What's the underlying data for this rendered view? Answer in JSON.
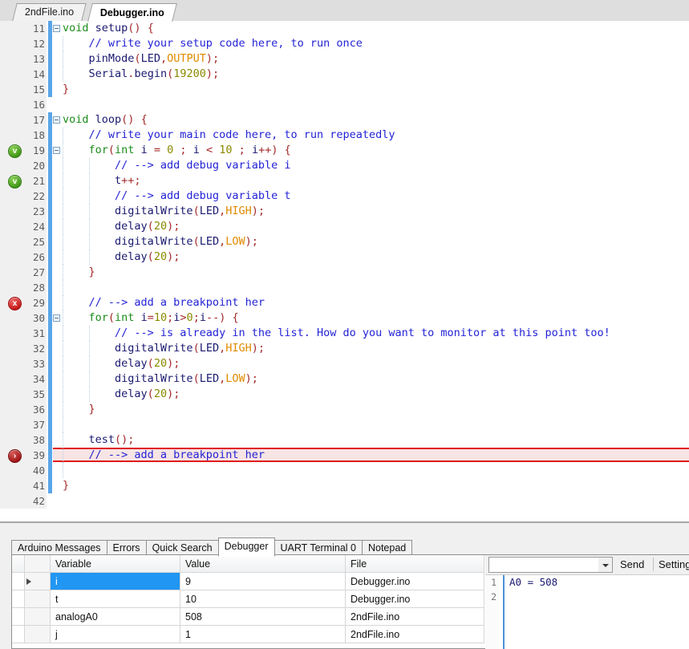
{
  "editor_tabs": [
    {
      "label": "2ndFile.ino",
      "active": false
    },
    {
      "label": "Debugger.ino",
      "active": true
    }
  ],
  "code": {
    "first_line": 11,
    "lines": [
      {
        "n": 11,
        "fold": true,
        "modified": true,
        "indent": 0,
        "marker": "none",
        "tokens": [
          {
            "t": "void",
            "c": "kw"
          },
          {
            "t": " ",
            "c": "pl"
          },
          {
            "t": "setup",
            "c": "id"
          },
          {
            "t": "()",
            "c": "op"
          },
          {
            "t": " ",
            "c": "pl"
          },
          {
            "t": "{",
            "c": "op"
          }
        ]
      },
      {
        "n": 12,
        "fold": false,
        "modified": true,
        "indent": 1,
        "marker": "none",
        "tokens": [
          {
            "t": "    // write your setup code here, to run once",
            "c": "cmt"
          }
        ]
      },
      {
        "n": 13,
        "fold": false,
        "modified": true,
        "indent": 1,
        "marker": "none",
        "tokens": [
          {
            "t": "    ",
            "c": "pl"
          },
          {
            "t": "pinMode",
            "c": "id"
          },
          {
            "t": "(",
            "c": "op"
          },
          {
            "t": "LED",
            "c": "id"
          },
          {
            "t": ",",
            "c": "op"
          },
          {
            "t": "OUTPUT",
            "c": "cst"
          },
          {
            "t": ");",
            "c": "op"
          }
        ]
      },
      {
        "n": 14,
        "fold": false,
        "modified": true,
        "indent": 1,
        "marker": "none",
        "tokens": [
          {
            "t": "    ",
            "c": "pl"
          },
          {
            "t": "Serial",
            "c": "id"
          },
          {
            "t": ".",
            "c": "op"
          },
          {
            "t": "begin",
            "c": "id"
          },
          {
            "t": "(",
            "c": "op"
          },
          {
            "t": "19200",
            "c": "num"
          },
          {
            "t": ");",
            "c": "op"
          }
        ]
      },
      {
        "n": 15,
        "fold": false,
        "modified": true,
        "indent": 0,
        "marker": "none",
        "tokens": [
          {
            "t": "}",
            "c": "op"
          }
        ]
      },
      {
        "n": 16,
        "fold": false,
        "modified": false,
        "indent": 0,
        "marker": "none",
        "tokens": []
      },
      {
        "n": 17,
        "fold": true,
        "modified": true,
        "indent": 0,
        "marker": "none",
        "tokens": [
          {
            "t": "void",
            "c": "kw"
          },
          {
            "t": " ",
            "c": "pl"
          },
          {
            "t": "loop",
            "c": "id"
          },
          {
            "t": "()",
            "c": "op"
          },
          {
            "t": " ",
            "c": "pl"
          },
          {
            "t": "{",
            "c": "op"
          }
        ]
      },
      {
        "n": 18,
        "fold": false,
        "modified": true,
        "indent": 1,
        "marker": "none",
        "tokens": [
          {
            "t": "    // write your main code here, to run repeatedly",
            "c": "cmt"
          }
        ]
      },
      {
        "n": 19,
        "fold": true,
        "modified": true,
        "indent": 1,
        "marker": "ok",
        "tokens": [
          {
            "t": "    ",
            "c": "pl"
          },
          {
            "t": "for",
            "c": "kw"
          },
          {
            "t": "(",
            "c": "op"
          },
          {
            "t": "int",
            "c": "kw"
          },
          {
            "t": " ",
            "c": "pl"
          },
          {
            "t": "i",
            "c": "id"
          },
          {
            "t": " ",
            "c": "pl"
          },
          {
            "t": "=",
            "c": "op"
          },
          {
            "t": " ",
            "c": "pl"
          },
          {
            "t": "0",
            "c": "num"
          },
          {
            "t": " ",
            "c": "pl"
          },
          {
            "t": ";",
            "c": "op"
          },
          {
            "t": " ",
            "c": "pl"
          },
          {
            "t": "i",
            "c": "id"
          },
          {
            "t": " ",
            "c": "pl"
          },
          {
            "t": "<",
            "c": "op"
          },
          {
            "t": " ",
            "c": "pl"
          },
          {
            "t": "10",
            "c": "num"
          },
          {
            "t": " ",
            "c": "pl"
          },
          {
            "t": ";",
            "c": "op"
          },
          {
            "t": " ",
            "c": "pl"
          },
          {
            "t": "i",
            "c": "id"
          },
          {
            "t": "++)",
            "c": "op"
          },
          {
            "t": " ",
            "c": "pl"
          },
          {
            "t": "{",
            "c": "op"
          }
        ]
      },
      {
        "n": 20,
        "fold": false,
        "modified": true,
        "indent": 2,
        "marker": "none",
        "tokens": [
          {
            "t": "        // --> add debug variable i",
            "c": "cmt"
          }
        ]
      },
      {
        "n": 21,
        "fold": false,
        "modified": true,
        "indent": 2,
        "marker": "ok",
        "tokens": [
          {
            "t": "        ",
            "c": "pl"
          },
          {
            "t": "t",
            "c": "id"
          },
          {
            "t": "++;",
            "c": "op"
          }
        ]
      },
      {
        "n": 22,
        "fold": false,
        "modified": true,
        "indent": 2,
        "marker": "none",
        "tokens": [
          {
            "t": "        // --> add debug variable t",
            "c": "cmt"
          }
        ]
      },
      {
        "n": 23,
        "fold": false,
        "modified": true,
        "indent": 2,
        "marker": "none",
        "tokens": [
          {
            "t": "        ",
            "c": "pl"
          },
          {
            "t": "digitalWrite",
            "c": "id"
          },
          {
            "t": "(",
            "c": "op"
          },
          {
            "t": "LED",
            "c": "id"
          },
          {
            "t": ",",
            "c": "op"
          },
          {
            "t": "HIGH",
            "c": "cst"
          },
          {
            "t": ");",
            "c": "op"
          }
        ]
      },
      {
        "n": 24,
        "fold": false,
        "modified": true,
        "indent": 2,
        "marker": "none",
        "tokens": [
          {
            "t": "        ",
            "c": "pl"
          },
          {
            "t": "delay",
            "c": "id"
          },
          {
            "t": "(",
            "c": "op"
          },
          {
            "t": "20",
            "c": "num"
          },
          {
            "t": ");",
            "c": "op"
          }
        ]
      },
      {
        "n": 25,
        "fold": false,
        "modified": true,
        "indent": 2,
        "marker": "none",
        "tokens": [
          {
            "t": "        ",
            "c": "pl"
          },
          {
            "t": "digitalWrite",
            "c": "id"
          },
          {
            "t": "(",
            "c": "op"
          },
          {
            "t": "LED",
            "c": "id"
          },
          {
            "t": ",",
            "c": "op"
          },
          {
            "t": "LOW",
            "c": "cst"
          },
          {
            "t": ");",
            "c": "op"
          }
        ]
      },
      {
        "n": 26,
        "fold": false,
        "modified": true,
        "indent": 2,
        "marker": "none",
        "tokens": [
          {
            "t": "        ",
            "c": "pl"
          },
          {
            "t": "delay",
            "c": "id"
          },
          {
            "t": "(",
            "c": "op"
          },
          {
            "t": "20",
            "c": "num"
          },
          {
            "t": ");",
            "c": "op"
          }
        ]
      },
      {
        "n": 27,
        "fold": false,
        "modified": true,
        "indent": 1,
        "marker": "none",
        "tokens": [
          {
            "t": "    ",
            "c": "pl"
          },
          {
            "t": "}",
            "c": "op"
          }
        ]
      },
      {
        "n": 28,
        "fold": false,
        "modified": true,
        "indent": 1,
        "marker": "none",
        "tokens": []
      },
      {
        "n": 29,
        "fold": false,
        "modified": true,
        "indent": 1,
        "marker": "err",
        "tokens": [
          {
            "t": "    // --> add a breakpoint her",
            "c": "cmt"
          }
        ]
      },
      {
        "n": 30,
        "fold": true,
        "modified": true,
        "indent": 1,
        "marker": "none",
        "tokens": [
          {
            "t": "    ",
            "c": "pl"
          },
          {
            "t": "for",
            "c": "kw"
          },
          {
            "t": "(",
            "c": "op"
          },
          {
            "t": "int",
            "c": "kw"
          },
          {
            "t": " ",
            "c": "pl"
          },
          {
            "t": "i",
            "c": "id"
          },
          {
            "t": "=",
            "c": "op"
          },
          {
            "t": "10",
            "c": "num"
          },
          {
            "t": ";",
            "c": "op"
          },
          {
            "t": "i",
            "c": "id"
          },
          {
            "t": ">",
            "c": "op"
          },
          {
            "t": "0",
            "c": "num"
          },
          {
            "t": ";",
            "c": "op"
          },
          {
            "t": "i",
            "c": "id"
          },
          {
            "t": "--)",
            "c": "op"
          },
          {
            "t": " ",
            "c": "pl"
          },
          {
            "t": "{",
            "c": "op"
          }
        ]
      },
      {
        "n": 31,
        "fold": false,
        "modified": true,
        "indent": 2,
        "marker": "none",
        "tokens": [
          {
            "t": "        // --> is already in the list. How do you want to monitor at this point too!",
            "c": "cmt"
          }
        ]
      },
      {
        "n": 32,
        "fold": false,
        "modified": true,
        "indent": 2,
        "marker": "none",
        "tokens": [
          {
            "t": "        ",
            "c": "pl"
          },
          {
            "t": "digitalWrite",
            "c": "id"
          },
          {
            "t": "(",
            "c": "op"
          },
          {
            "t": "LED",
            "c": "id"
          },
          {
            "t": ",",
            "c": "op"
          },
          {
            "t": "HIGH",
            "c": "cst"
          },
          {
            "t": ");",
            "c": "op"
          }
        ]
      },
      {
        "n": 33,
        "fold": false,
        "modified": true,
        "indent": 2,
        "marker": "none",
        "tokens": [
          {
            "t": "        ",
            "c": "pl"
          },
          {
            "t": "delay",
            "c": "id"
          },
          {
            "t": "(",
            "c": "op"
          },
          {
            "t": "20",
            "c": "num"
          },
          {
            "t": ");",
            "c": "op"
          }
        ]
      },
      {
        "n": 34,
        "fold": false,
        "modified": true,
        "indent": 2,
        "marker": "none",
        "tokens": [
          {
            "t": "        ",
            "c": "pl"
          },
          {
            "t": "digitalWrite",
            "c": "id"
          },
          {
            "t": "(",
            "c": "op"
          },
          {
            "t": "LED",
            "c": "id"
          },
          {
            "t": ",",
            "c": "op"
          },
          {
            "t": "LOW",
            "c": "cst"
          },
          {
            "t": ");",
            "c": "op"
          }
        ]
      },
      {
        "n": 35,
        "fold": false,
        "modified": true,
        "indent": 2,
        "marker": "none",
        "tokens": [
          {
            "t": "        ",
            "c": "pl"
          },
          {
            "t": "delay",
            "c": "id"
          },
          {
            "t": "(",
            "c": "op"
          },
          {
            "t": "20",
            "c": "num"
          },
          {
            "t": ");",
            "c": "op"
          }
        ]
      },
      {
        "n": 36,
        "fold": false,
        "modified": true,
        "indent": 1,
        "marker": "none",
        "tokens": [
          {
            "t": "    ",
            "c": "pl"
          },
          {
            "t": "}",
            "c": "op"
          }
        ]
      },
      {
        "n": 37,
        "fold": false,
        "modified": true,
        "indent": 1,
        "marker": "none",
        "tokens": []
      },
      {
        "n": 38,
        "fold": false,
        "modified": true,
        "indent": 1,
        "marker": "none",
        "tokens": [
          {
            "t": "    ",
            "c": "pl"
          },
          {
            "t": "test",
            "c": "id"
          },
          {
            "t": "();",
            "c": "op"
          }
        ]
      },
      {
        "n": 39,
        "fold": false,
        "modified": true,
        "indent": 1,
        "marker": "current",
        "exec": true,
        "tokens": [
          {
            "t": "    // --> add a breakpoint her",
            "c": "cmt"
          }
        ]
      },
      {
        "n": 40,
        "fold": false,
        "modified": true,
        "indent": 1,
        "marker": "none",
        "tokens": []
      },
      {
        "n": 41,
        "fold": false,
        "modified": true,
        "indent": 0,
        "marker": "none",
        "tokens": [
          {
            "t": "}",
            "c": "op"
          }
        ]
      },
      {
        "n": 42,
        "fold": false,
        "modified": false,
        "indent": 0,
        "marker": "none",
        "tokens": []
      }
    ],
    "marker_glyphs": {
      "ok": "v",
      "err": "x",
      "current": "›"
    }
  },
  "bottom_tabs": [
    {
      "label": "Arduino Messages",
      "active": false
    },
    {
      "label": "Errors",
      "active": false
    },
    {
      "label": "Quick Search",
      "active": false
    },
    {
      "label": "Debugger",
      "active": true
    },
    {
      "label": "UART Terminal 0",
      "active": false
    },
    {
      "label": "Notepad",
      "active": false
    }
  ],
  "debugger_grid": {
    "columns": [
      "Variable",
      "Value",
      "File"
    ],
    "rows": [
      {
        "variable": "i",
        "value": "9",
        "file": "Debugger.ino",
        "selected": true
      },
      {
        "variable": "t",
        "value": "10",
        "file": "Debugger.ino",
        "selected": false
      },
      {
        "variable": "analogA0",
        "value": "508",
        "file": "2ndFile.ino",
        "selected": false
      },
      {
        "variable": "j",
        "value": "1",
        "file": "2ndFile.ino",
        "selected": false
      }
    ]
  },
  "uart": {
    "command_value": "",
    "command_placeholder": "",
    "send_label": "Send",
    "settings_label": "Settings",
    "console_lines": [
      {
        "n": "1",
        "text": "A0 = 508"
      },
      {
        "n": "2",
        "text": ""
      }
    ]
  },
  "colors": {
    "selection_blue": "#2196f3",
    "exec_border": "#e01b1b",
    "exec_fill": "#f7e4e4",
    "change_bar": "#5aa6e8",
    "marker_ok": "#3f9416",
    "marker_err": "#c21414",
    "marker_current": "#9e1212",
    "comment": "#2323d6",
    "keyword": "#1c8c1c",
    "identifier": "#191970",
    "number": "#8a8a00",
    "operator": "#a52a2a",
    "constant": "#e08a00"
  }
}
